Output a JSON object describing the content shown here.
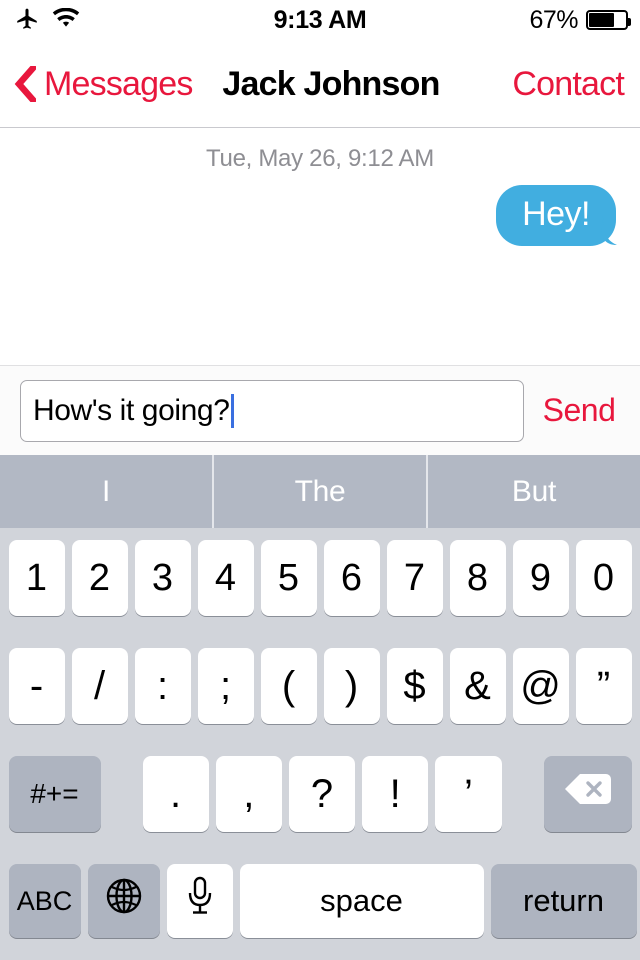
{
  "status_bar": {
    "airplane_icon": "airplane-mode-icon",
    "wifi_icon": "wifi-icon",
    "time": "9:13 AM",
    "battery_percent": "67%",
    "battery_level": 67
  },
  "nav_bar": {
    "back_icon": "chevron-left-icon",
    "back_label": "Messages",
    "title": "Jack Johnson",
    "right_action": "Contact"
  },
  "conversation": {
    "timestamp": "Tue, May 26, 9:12 AM",
    "messages": [
      {
        "text": "Hey!",
        "side": "outgoing",
        "bubble_color": "#41aee0"
      }
    ]
  },
  "input_bar": {
    "value": "How's it going?",
    "placeholder": "iMessage",
    "send_label": "Send",
    "accent_color": "#e8173d"
  },
  "predictive_bar": {
    "suggestions": [
      "I",
      "The",
      "But"
    ]
  },
  "keyboard": {
    "row1": [
      "1",
      "2",
      "3",
      "4",
      "5",
      "6",
      "7",
      "8",
      "9",
      "0"
    ],
    "row2": [
      "-",
      "/",
      ":",
      ";",
      "(",
      ")",
      "$",
      "&",
      "@",
      "”"
    ],
    "row3": {
      "mode_key": "#+=",
      "keys": [
        ".",
        ",",
        "?",
        "!",
        "’"
      ],
      "delete_icon": "backspace-delete-icon"
    },
    "row4": {
      "abc_key": "ABC",
      "globe_icon": "globe-keyboard-icon",
      "mic_icon": "microphone-icon",
      "space_key": "space",
      "return_key": "return"
    }
  },
  "colors": {
    "accent_red": "#e8173d",
    "bubble_blue": "#41aee0",
    "keyboard_bg": "#d1d4da",
    "key_dark": "#aeb4c0",
    "predictive_bg": "#b2b8c4",
    "timestamp_gray": "#8e8e93"
  }
}
